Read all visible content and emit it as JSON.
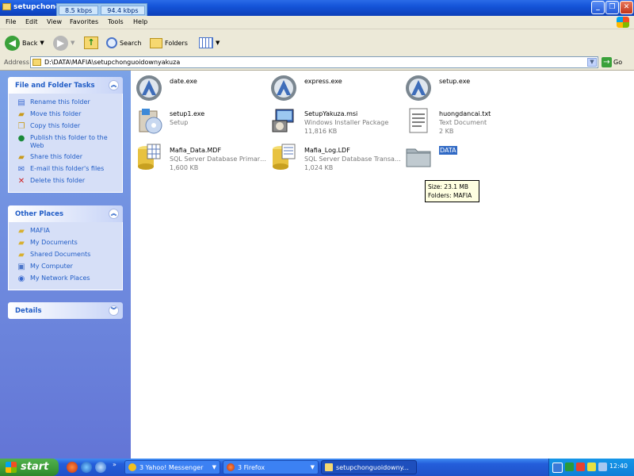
{
  "window": {
    "title": "setupchong",
    "speed": [
      "8.5 kbps",
      "94.4 kbps"
    ]
  },
  "menu": [
    "File",
    "Edit",
    "View",
    "Favorites",
    "Tools",
    "Help"
  ],
  "toolbar": {
    "back": "Back",
    "search": "Search",
    "folders": "Folders"
  },
  "address": {
    "label": "Address",
    "path": "D:\\DATA\\MAFIA\\setupchonguoidownyakuza",
    "go": "Go"
  },
  "tasks_panel": {
    "title": "File and Folder Tasks",
    "items": [
      {
        "label": "Rename this folder",
        "icon": "rename-icon"
      },
      {
        "label": "Move this folder",
        "icon": "move-icon"
      },
      {
        "label": "Copy this folder",
        "icon": "copy-icon"
      },
      {
        "label": "Publish this folder to the Web",
        "icon": "publish-web-icon"
      },
      {
        "label": "Share this folder",
        "icon": "share-icon"
      },
      {
        "label": "E-mail this folder's files",
        "icon": "email-icon"
      },
      {
        "label": "Delete this folder",
        "icon": "delete-icon"
      }
    ]
  },
  "places_panel": {
    "title": "Other Places",
    "items": [
      {
        "label": "MAFIA",
        "icon": "folder-icon"
      },
      {
        "label": "My Documents",
        "icon": "folder-icon"
      },
      {
        "label": "Shared Documents",
        "icon": "folder-icon"
      },
      {
        "label": "My Computer",
        "icon": "computer-icon"
      },
      {
        "label": "My Network Places",
        "icon": "network-icon"
      }
    ]
  },
  "details_panel": {
    "title": "Details"
  },
  "files": [
    {
      "name": "date.exe",
      "type": "",
      "size": "",
      "icon": "exe-icon"
    },
    {
      "name": "express.exe",
      "type": "",
      "size": "",
      "icon": "exe-icon"
    },
    {
      "name": "setup.exe",
      "type": "",
      "size": "",
      "icon": "exe-icon"
    },
    {
      "name": "setup1.exe",
      "type": "Setup",
      "size": "",
      "icon": "setup-icon"
    },
    {
      "name": "SetupYakuza.msi",
      "type": "Windows Installer Package",
      "size": "11,816 KB",
      "icon": "msi-icon"
    },
    {
      "name": "huongdancai.txt",
      "type": "Text Document",
      "size": "2 KB",
      "icon": "text-file-icon"
    },
    {
      "name": "Mafia_Data.MDF",
      "type": "SQL Server Database Primary ...",
      "size": "1,600 KB",
      "icon": "database-icon"
    },
    {
      "name": "Mafia_Log.LDF",
      "type": "SQL Server Database Transac...",
      "size": "1,024 KB",
      "icon": "database-icon"
    },
    {
      "name": "DATA",
      "type": "",
      "size": "",
      "icon": "folder-icon",
      "selected": true
    }
  ],
  "tooltip": {
    "size": "Size: 23.1 MB",
    "folders": "Folders: MAFIA"
  },
  "taskbar": {
    "start": "start",
    "tasks": [
      {
        "label": "3 Yahoo! Messenger",
        "icon": "yahoo-icon"
      },
      {
        "label": "3 Firefox",
        "icon": "firefox-icon"
      },
      {
        "label": "setupchonguoidowny...",
        "icon": "folder-icon",
        "active": true
      }
    ],
    "clock": "12:40"
  }
}
